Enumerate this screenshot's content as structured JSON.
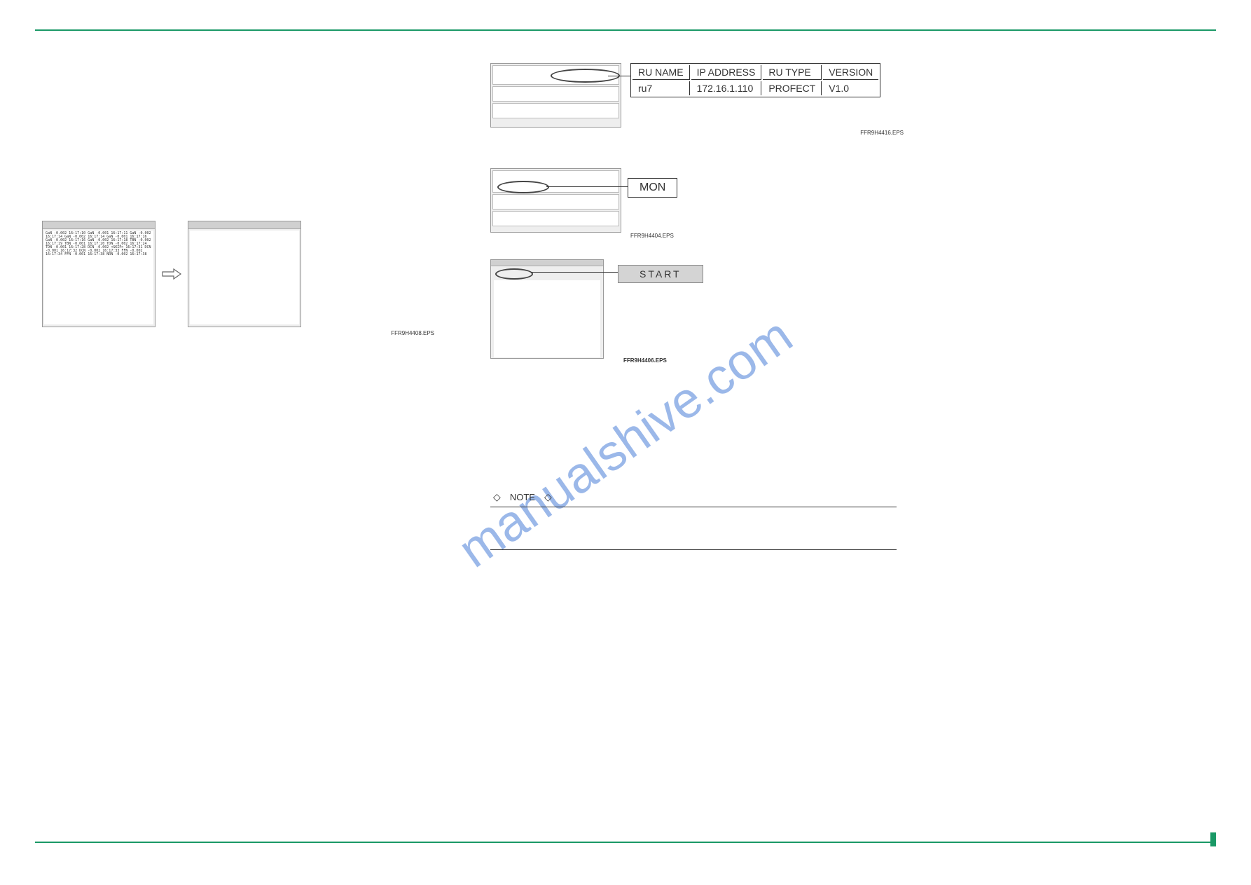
{
  "watermark": "manualshive.com",
  "figRefs": {
    "leftPair": "FFR9H4408.EPS",
    "rightTop": "FFR9H4416.EPS",
    "rightMid": "FFR9H4404.EPS",
    "rightBot": "FFR9H4406.EPS"
  },
  "infoTable": {
    "headers": [
      "RU NAME",
      "IP ADDRESS",
      "RU TYPE",
      "VERSION"
    ],
    "row": [
      "ru7",
      "172.16.1.110",
      "PROFECT",
      "V1.0"
    ]
  },
  "monLabel": "MON",
  "startLabel": "START",
  "noteLabel": "NOTE",
  "logSample": "GaN  -0.002                  16:17:10\nGaN  -0.001                  16:17:11\nGaN  -0.002                  16:17:14\nGaN  -0.002                  16:17:14\nGaN  -0.001                  16:17:16\nGaN  -0.002                  16:17:16\nGaN  -0.002                  16:17:18\nTBN  -0.002                  16:17:19\nTBN  -0.001                  16:17:20\nTDN  -0.002                  16:17:24\nTDN  -0.001                  16:17:28\nDCN  -0.002       <SKIP>     16:17:31\nDCN  -0.001                  16:17:32\nDCN  -0.002                  16:17:33\nFFN  -0.002                  16:17:34\nFFN  -0.001                  16:17:38\nNRN  -0.002                  16:17:38"
}
